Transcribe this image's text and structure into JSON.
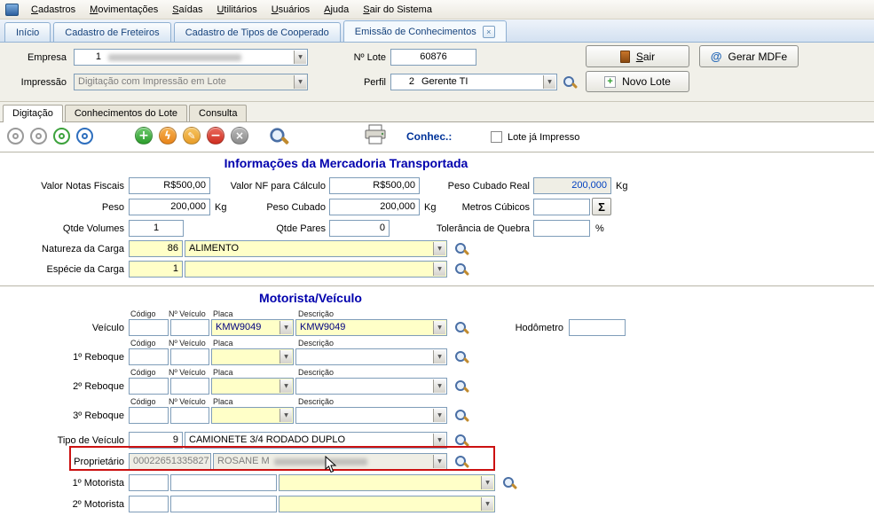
{
  "icons": {
    "dropdown": "▼",
    "close": "×",
    "plus": "+",
    "lightning": "ϟ",
    "pencil": "✎",
    "minus": "−",
    "cancel": "×",
    "at": "@"
  },
  "menu": {
    "items": [
      "Cadastros",
      "Movimentações",
      "Saídas",
      "Utilitários",
      "Usuários",
      "Ajuda",
      "Sair do Sistema"
    ]
  },
  "tabs": {
    "items": [
      "Início",
      "Cadastro de Freteiros",
      "Cadastro de Tipos de Cooperado",
      "Emissão de Conhecimentos"
    ]
  },
  "header": {
    "empresa_label": "Empresa",
    "empresa_code": "1",
    "lote_label": "Nº Lote",
    "lote_value": "60876",
    "impressao_label": "Impressão",
    "impressao_value": "Digitação com Impressão em Lote",
    "perfil_label": "Perfil",
    "perfil_code": "2",
    "perfil_value": "Gerente TI",
    "sair_label": "Sair",
    "gerar_mdfe_label": "Gerar MDFe",
    "novo_lote_label": "Novo Lote"
  },
  "subtabs": {
    "items": [
      "Digitação",
      "Conhecimentos do Lote",
      "Consulta"
    ]
  },
  "toolbar": {
    "conhec_label": "Conhec.:",
    "lote_impresso_label": "Lote já Impresso"
  },
  "mercadoria": {
    "title": "Informações da Mercadoria Transportada",
    "valor_notas_label": "Valor Notas Fiscais",
    "valor_notas_value": "R$500,00",
    "valor_nf_calc_label": "Valor NF para Cálculo",
    "valor_nf_calc_value": "R$500,00",
    "peso_cubado_real_label": "Peso Cubado Real",
    "peso_cubado_real_value": "200,000",
    "peso_label": "Peso",
    "peso_value": "200,000",
    "peso_cubado_label": "Peso Cubado",
    "peso_cubado_value": "200,000",
    "metros_cubicos_label": "Metros Cúbicos",
    "qtde_volumes_label": "Qtde Volumes",
    "qtde_volumes_value": "1",
    "qtde_pares_label": "Qtde Pares",
    "qtde_pares_value": "0",
    "tolerancia_label": "Tolerância de Quebra",
    "natureza_label": "Natureza da Carga",
    "natureza_code": "86",
    "natureza_value": "ALIMENTO",
    "especie_label": "Espécie da Carga",
    "especie_code": "1",
    "kg_unit": "Kg",
    "percent_unit": "%",
    "sigma": "Σ"
  },
  "veiculos": {
    "title": "Motorista/Veículo",
    "col_codigo": "Código",
    "col_num": "Nº Veículo",
    "col_placa": "Placa",
    "col_desc": "Descrição",
    "veiculo_label": "Veículo",
    "veiculo_placa": "KMW9049",
    "veiculo_desc": "KMW9049",
    "hodometro_label": "Hodômetro",
    "reboque1_label": "1º Reboque",
    "reboque2_label": "2º Reboque",
    "reboque3_label": "3º Reboque",
    "tipo_label": "Tipo de Veículo",
    "tipo_code": "9",
    "tipo_value": "CAMIONETE 3/4 RODADO DUPLO",
    "proprietario_label": "Proprietário",
    "proprietario_code": "00022651335827",
    "proprietario_value": "ROSANE M",
    "motorista1_label": "1º Motorista",
    "motorista2_label": "2º Motorista"
  }
}
